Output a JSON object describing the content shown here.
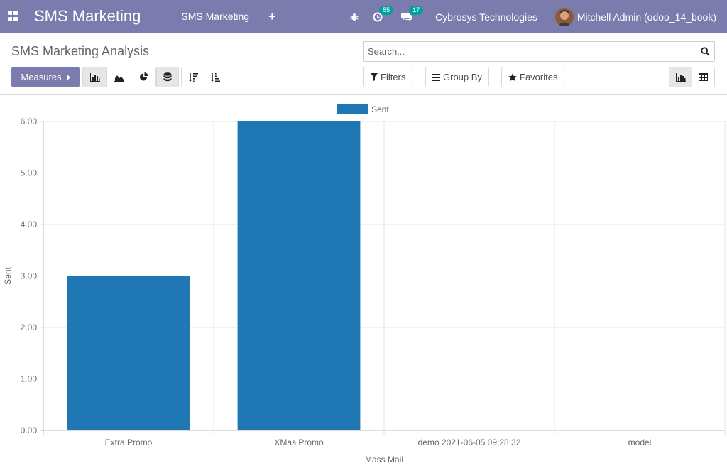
{
  "navbar": {
    "app_name": "SMS Marketing",
    "menu_item": "SMS Marketing",
    "activity_count": "55",
    "message_count": "17",
    "company": "Cybrosys Technologies",
    "user": "Mitchell Admin (odoo_14_book)",
    "color": "#7c7bad"
  },
  "control_panel": {
    "title": "SMS Marketing Analysis",
    "search_placeholder": "Search...",
    "measures_label": "Measures",
    "filters_label": "Filters",
    "group_by_label": "Group By",
    "favorites_label": "Favorites"
  },
  "chart_data": {
    "type": "bar",
    "categories": [
      "Extra Promo",
      "XMas Promo",
      "demo 2021-06-05 09:28:32",
      "model"
    ],
    "series": [
      {
        "name": "Sent",
        "values": [
          3,
          6,
          0,
          0
        ],
        "color": "#1f77b4"
      }
    ],
    "xlabel": "Mass Mail",
    "ylabel": "Sent",
    "ylim": [
      0,
      6
    ],
    "yticks": [
      "0.00",
      "1.00",
      "2.00",
      "3.00",
      "4.00",
      "5.00",
      "6.00"
    ],
    "grid": true,
    "legend": "top-center"
  }
}
